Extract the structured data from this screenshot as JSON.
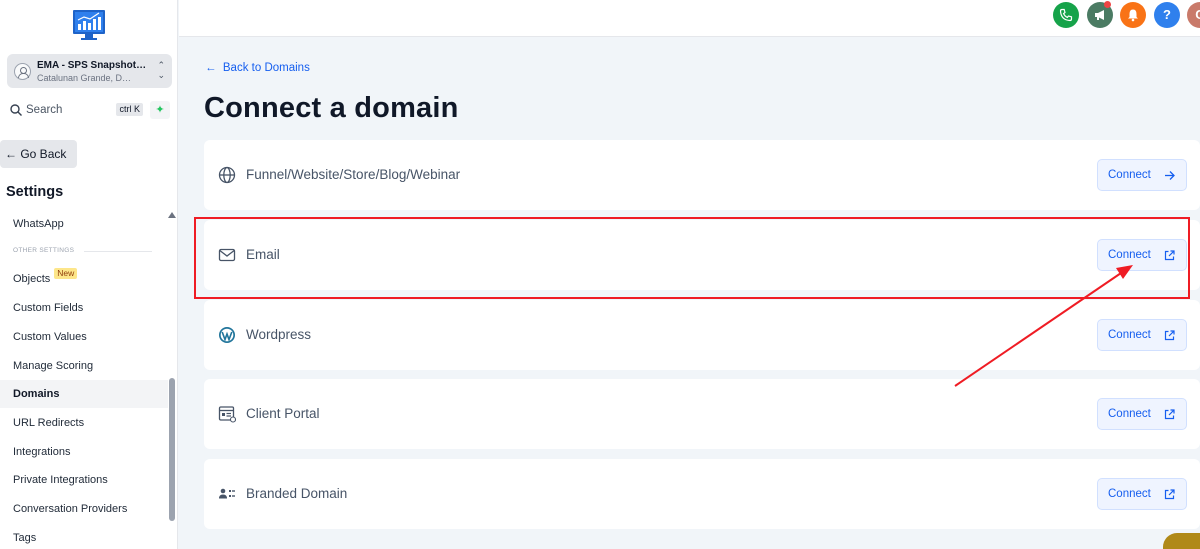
{
  "sidebar": {
    "account": {
      "name": "EMA - SPS Snapshot…",
      "location": "Catalunan Grande, D…"
    },
    "search": {
      "label": "Search",
      "shortcut": "ctrl K"
    },
    "go_back": "Go Back",
    "settings_title": "Settings",
    "other_settings_label": "OTHER SETTINGS",
    "items": [
      {
        "label": "WhatsApp"
      },
      {
        "label": "Objects",
        "badge": "New"
      },
      {
        "label": "Custom Fields"
      },
      {
        "label": "Custom Values"
      },
      {
        "label": "Manage Scoring"
      },
      {
        "label": "Domains",
        "active": true
      },
      {
        "label": "URL Redirects"
      },
      {
        "label": "Integrations"
      },
      {
        "label": "Private Integrations"
      },
      {
        "label": "Conversation Providers"
      },
      {
        "label": "Tags"
      }
    ]
  },
  "topbar": {
    "help_label": "?",
    "avatar_initial": "C",
    "colors": {
      "phone": "#16a34a",
      "megaphone": "#4b7b63",
      "bell": "#f97316",
      "help": "#2f80ed",
      "avatar": "#c97a6a"
    }
  },
  "main": {
    "back_link": "Back to Domains",
    "title": "Connect a domain",
    "rows": [
      {
        "label": "Funnel/Website/Store/Blog/Webinar",
        "icon": "globe-icon",
        "button": "Connect",
        "button_icon": "arrow-right-icon"
      },
      {
        "label": "Email",
        "icon": "mail-icon",
        "button": "Connect",
        "button_icon": "external-link-icon"
      },
      {
        "label": "Wordpress",
        "icon": "wordpress-icon",
        "button": "Connect",
        "button_icon": "external-link-icon"
      },
      {
        "label": "Client Portal",
        "icon": "client-portal-icon",
        "button": "Connect",
        "button_icon": "external-link-icon"
      },
      {
        "label": "Branded Domain",
        "icon": "branded-domain-icon",
        "button": "Connect",
        "button_icon": "external-link-icon"
      }
    ]
  },
  "annotation": {
    "highlight_color": "#ef1c24"
  }
}
